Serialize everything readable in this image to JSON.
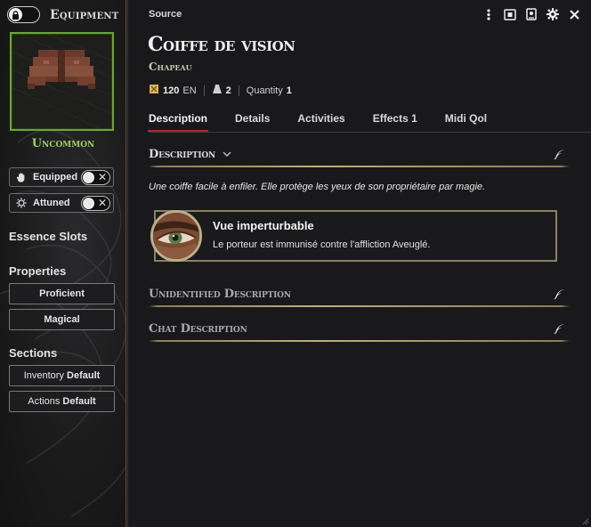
{
  "sidebar": {
    "title": "Equipment",
    "rarity": "Uncommon",
    "toggles": [
      {
        "label": "Equipped",
        "icon": "hand-icon"
      },
      {
        "label": "Attuned",
        "icon": "sun-gear-icon"
      }
    ],
    "essence_heading": "Essence Slots",
    "properties_heading": "Properties",
    "properties": [
      "Proficient",
      "Magical"
    ],
    "sections_heading": "Sections",
    "sections": [
      {
        "label": "Inventory",
        "value": "Default"
      },
      {
        "label": "Actions",
        "value": "Default"
      }
    ]
  },
  "header": {
    "source_label": "Source",
    "item_name": "Coiffe de vision",
    "item_type": "Chapeau",
    "price_value": "120",
    "price_unit": "EN",
    "weight_value": "2",
    "quantity_label": "Quantity",
    "quantity_value": "1"
  },
  "tabs": [
    {
      "label": "Description",
      "active": true
    },
    {
      "label": "Details"
    },
    {
      "label": "Activities"
    },
    {
      "label": "Effects",
      "count": "1"
    },
    {
      "label": "Midi Qol"
    }
  ],
  "sections": {
    "description_title": "Description",
    "description_text": "Une coiffe facile à enfiler. Elle protège les yeux de son propriétaire par magie.",
    "feature_title": "Vue imperturbable",
    "feature_text": "Le porteur est immunisé contre l'affliction Aveuglé.",
    "unidentified_title": "Unidentified Description",
    "chat_title": "Chat Description"
  },
  "colors": {
    "accent_red": "#b3262a",
    "rarity_green": "#9bd063",
    "gold_rule": "#bfae7a"
  }
}
